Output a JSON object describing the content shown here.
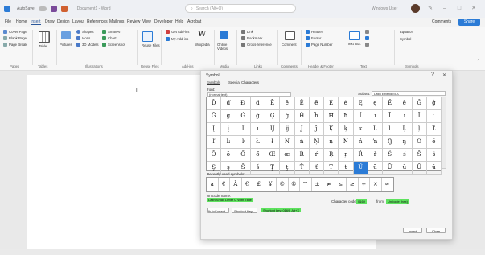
{
  "titlebar": {
    "autosave": "AutoSave",
    "doc_title": "Document1 - Word",
    "search_placeholder": "Search (Alt+Q)",
    "user": "Windows User"
  },
  "menu": {
    "tabs": [
      "File",
      "Home",
      "Insert",
      "Draw",
      "Design",
      "Layout",
      "References",
      "Mailings",
      "Review",
      "View",
      "Developer",
      "Help",
      "Acrobat"
    ],
    "active": "Insert",
    "comments": "Comments",
    "share": "Share"
  },
  "ribbon": {
    "pages": [
      "Cover Page",
      "Blank Page",
      "Page Break"
    ],
    "pages_label": "Pages",
    "table": "Table",
    "tables_label": "Tables",
    "pictures": "Pictures",
    "shapes": "Shapes",
    "icons": "Icons",
    "models": "3D Models",
    "smartart": "SmartArt",
    "chart": "Chart",
    "screenshot": "Screenshot",
    "illustrations_label": "Illustrations",
    "reuse_files": "Reuse Files",
    "reuse_label": "Reuse Files",
    "getaddins": "Get Add-ins",
    "myaddins": "My Add-ins",
    "wikipedia": "Wikipedia",
    "addins_label": "Add-ins",
    "online_videos": "Online Videos",
    "media_label": "Media",
    "link": "Link",
    "bookmark": "Bookmark",
    "crossref": "Cross-reference",
    "links_label": "Links",
    "comment": "Comment",
    "comments_label": "Comments",
    "header": "Header",
    "footer": "Footer",
    "page_number": "Page Number",
    "hf_label": "Header & Footer",
    "textbox": "Text Box",
    "text_label": "Text",
    "equation": "Equation",
    "symbol": "Symbol",
    "symbols_label": "Symbols"
  },
  "dialog": {
    "title": "Symbol",
    "help": "?",
    "close": "✕",
    "tabs": [
      "Symbols",
      "Special Characters"
    ],
    "font_label": "Font:",
    "font_value": "(normal text)",
    "subset_label": "Subset:",
    "subset_value": "Latin Extended-A",
    "grid": [
      [
        "Ď",
        "ď",
        "Đ",
        "đ",
        "Ē",
        "ē",
        "Ĕ",
        "ĕ",
        "Ė",
        "ė",
        "Ę",
        "ę",
        "Ě",
        "ě",
        "Ĝ",
        "ĝ"
      ],
      [
        "Ğ",
        "ğ",
        "Ġ",
        "ġ",
        "Ģ",
        "ģ",
        "Ĥ",
        "ĥ",
        "Ħ",
        "ħ",
        "Ĩ",
        "ĩ",
        "Ī",
        "ī",
        "Ĭ",
        "ĭ"
      ],
      [
        "Į",
        "į",
        "İ",
        "ı",
        "Ĳ",
        "ĳ",
        "Ĵ",
        "ĵ",
        "Ķ",
        "ķ",
        "ĸ",
        "Ĺ",
        "ĺ",
        "Ļ",
        "ļ",
        "Ľ"
      ],
      [
        "ľ",
        "Ŀ",
        "ŀ",
        "Ł",
        "ł",
        "Ń",
        "ń",
        "Ņ",
        "ņ",
        "Ň",
        "ň",
        "ŉ",
        "Ŋ",
        "ŋ",
        "Ō",
        "ō"
      ],
      [
        "Ŏ",
        "ŏ",
        "Ő",
        "ő",
        "Œ",
        "œ",
        "Ŕ",
        "ŕ",
        "Ŗ",
        "ŗ",
        "Ř",
        "ř",
        "Ś",
        "ś",
        "Ŝ",
        "ŝ"
      ],
      [
        "Ş",
        "ş",
        "Š",
        "š",
        "Ţ",
        "ţ",
        "Ť",
        "ť",
        "Ŧ",
        "ŧ",
        "Ũ",
        "ũ",
        "Ū",
        "ū",
        "Ŭ",
        "ŭ"
      ]
    ],
    "selected_cell": [
      5,
      10
    ],
    "recent_label": "Recently used symbols:",
    "recent": [
      "a",
      "€",
      "Â",
      "€",
      "£",
      "¥",
      "©",
      "®",
      "™",
      "±",
      "≠",
      "≤",
      "≥",
      "÷",
      "×",
      "∞"
    ],
    "unicode_name_label": "Unicode name:",
    "unicode_name": "Latin Small Letter U With Tilde",
    "char_code_label": "Character code:",
    "char_code": "0169",
    "from_label": "from:",
    "from_value": "Unicode (hex)",
    "autocorrect": "AutoCorrect...",
    "shortcut_key": "Shortcut Key...",
    "shortcut_text": "Shortcut key: 0169, Alt+X",
    "insert": "Insert",
    "cancel": "Close"
  },
  "colors": {
    "accent": "#2b7bd6",
    "highlight": "#5ee25e"
  }
}
